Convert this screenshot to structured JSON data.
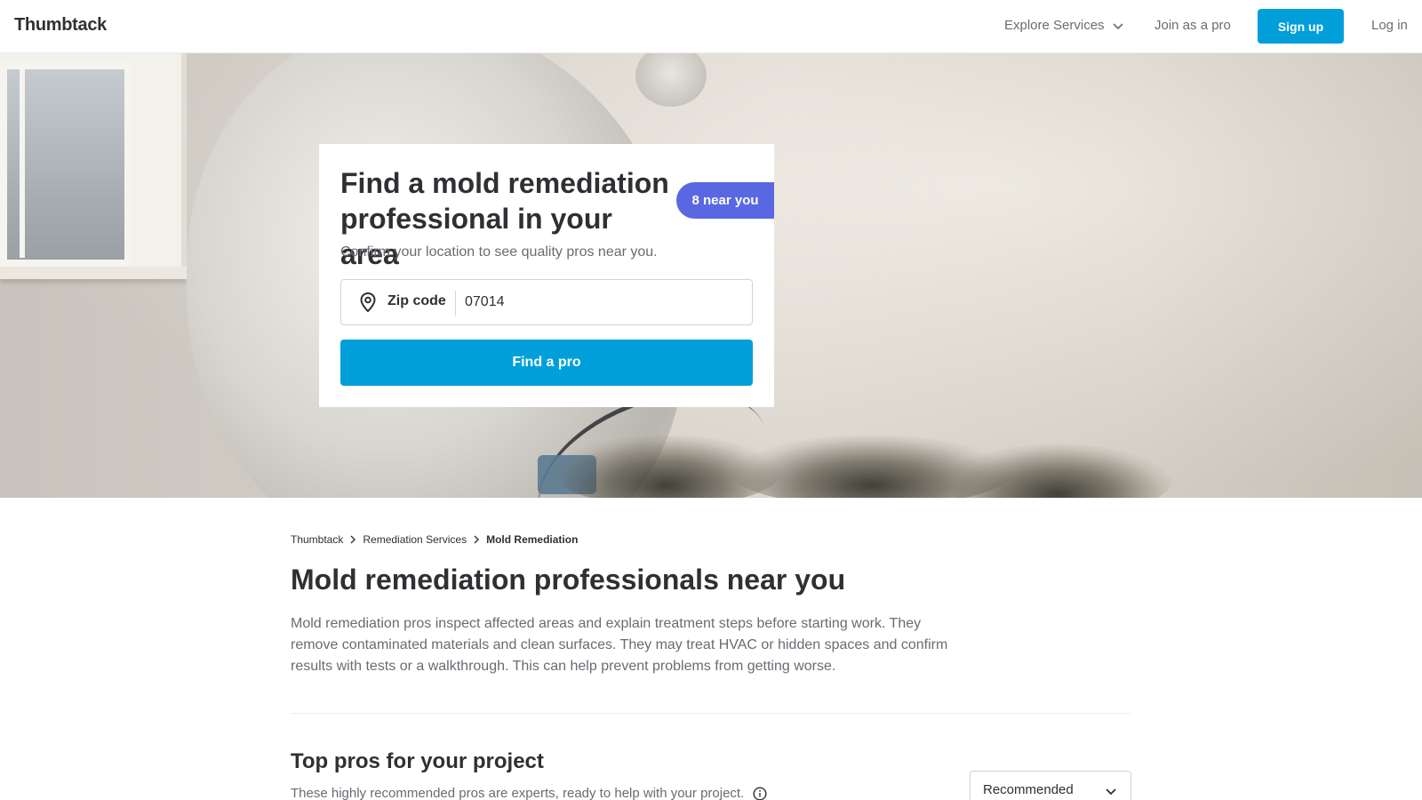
{
  "header": {
    "logo": "Thumbtack",
    "explore_label": "Explore Services",
    "join_label": "Join as a pro",
    "signup_label": "Sign up",
    "login_label": "Log in"
  },
  "search_card": {
    "title": "Find a mold remediation professional in your area",
    "badge": "8 near you",
    "subtitle": "Confirm your location to see quality pros near you.",
    "zip_label": "Zip code",
    "zip_value": "07014",
    "find_button": "Find a pro"
  },
  "breadcrumb": {
    "items": [
      "Thumbtack",
      "Remediation Services",
      "Mold Remediation"
    ]
  },
  "main": {
    "title": "Mold remediation professionals near you",
    "description": "Mold remediation pros inspect affected areas and explain treatment steps before starting work. They remove contaminated materials and clean surfaces. They may treat HVAC or hidden spaces and confirm results with tests or a walkthrough. This can help prevent problems from getting worse.",
    "section_title": "Top pros for your project",
    "section_subtitle": "These highly recommended pros are experts, ready to help with your project.",
    "sort_value": "Recommended"
  },
  "colors": {
    "primary": "#009fd9",
    "badge": "#5968e2",
    "text": "#2f3033",
    "muted": "#676d73"
  },
  "icons": [
    "chevron-down-icon",
    "location-pin-icon",
    "chevron-right-icon",
    "info-icon"
  ]
}
